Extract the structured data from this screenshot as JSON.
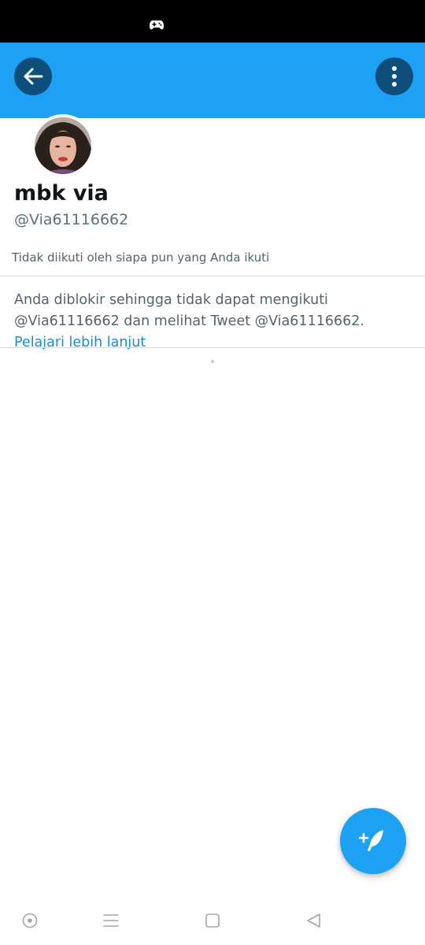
{
  "status_bar": {
    "icon": "gamepad-icon"
  },
  "header": {
    "back_icon": "arrow-left-icon",
    "more_icon": "more-vertical-icon",
    "color": "#1da1f2"
  },
  "profile": {
    "avatar_icon": "avatar",
    "name": "mbk via",
    "handle": "@Via61116662",
    "followers_note": "Tidak diikuti oleh siapa pun yang Anda ikuti"
  },
  "blocked_notice": {
    "message": "Anda diblokir sehingga tidak dapat mengikuti @Via61116662 dan melihat Tweet @Via61116662. ",
    "link_label": "Pelajari lebih lanjut",
    "link_color": "#1b8bd6"
  },
  "fab": {
    "icon": "compose-tweet-icon",
    "color": "#1da1f2"
  },
  "system_nav": {
    "icons": [
      "assistant-dot-icon",
      "recents-menu-icon",
      "home-square-icon",
      "back-triangle-icon"
    ]
  }
}
